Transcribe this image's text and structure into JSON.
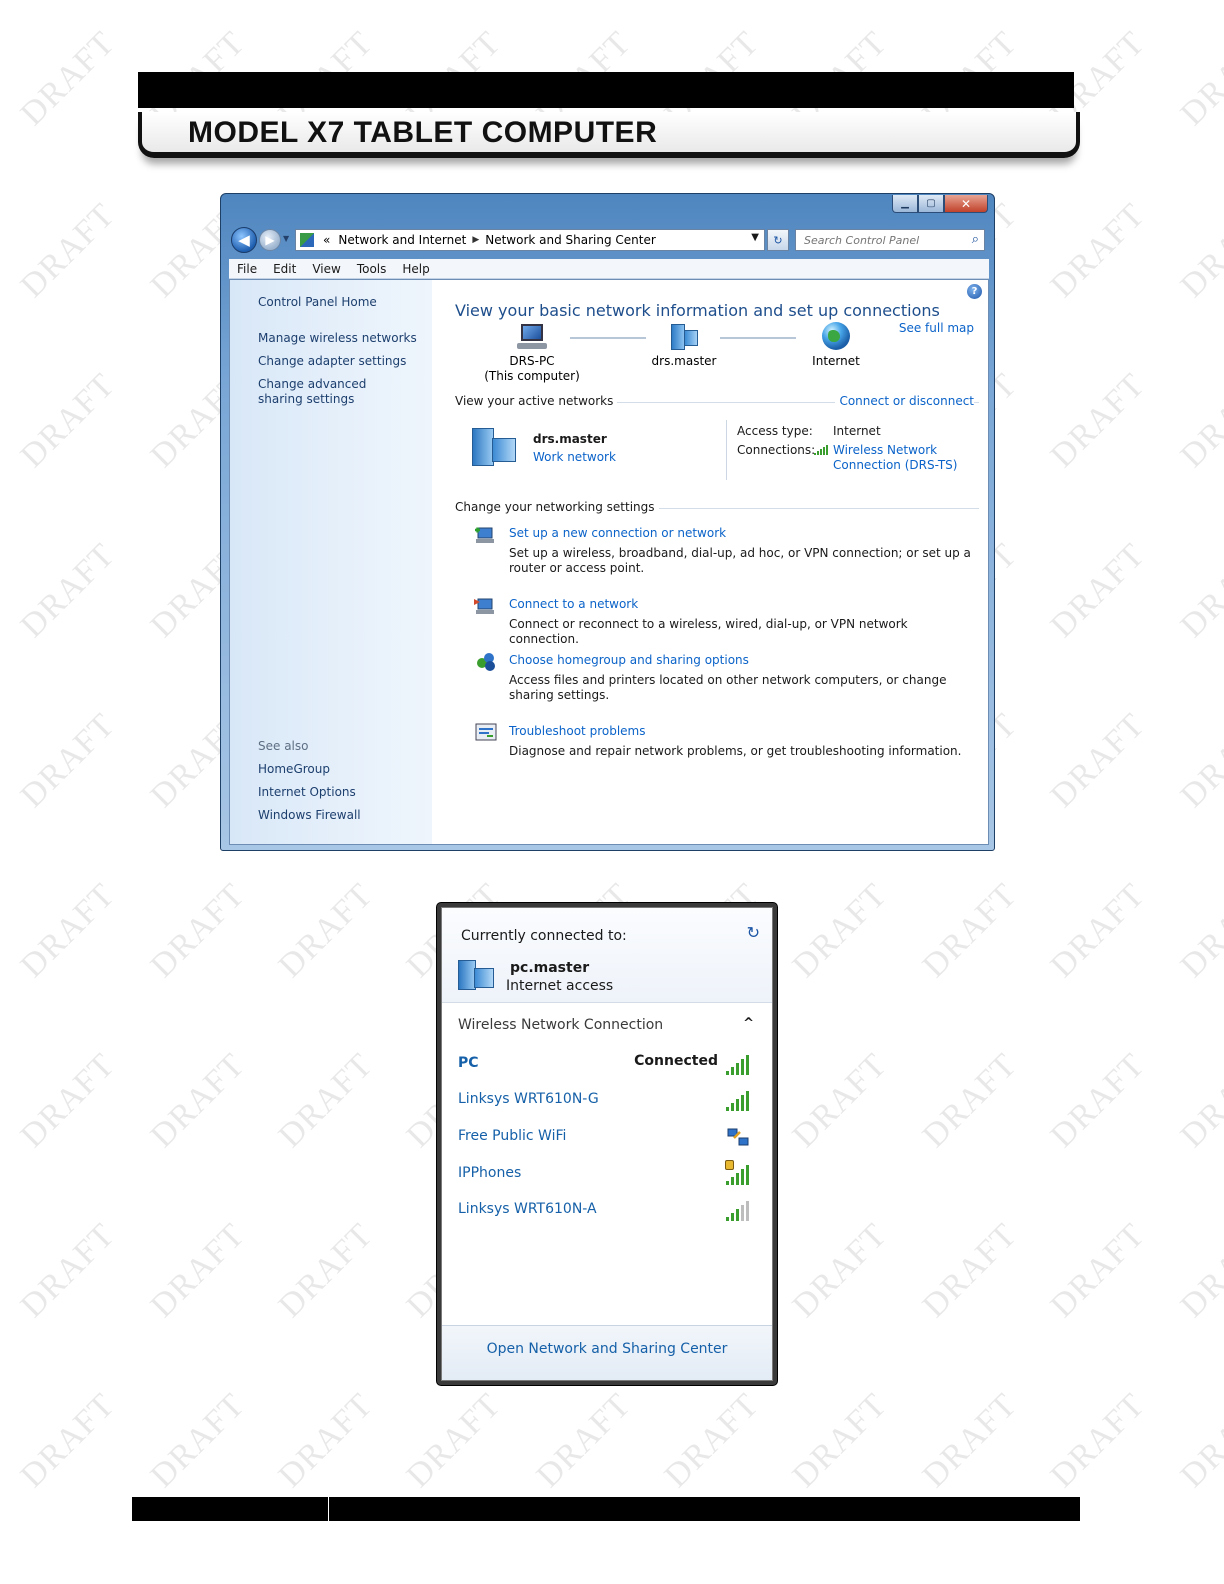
{
  "document": {
    "header_title": "MODEL X7 TABLET COMPUTER",
    "watermark": "DRAFT"
  },
  "window": {
    "address": {
      "overflow": "«",
      "crumbs": [
        "Network and Internet",
        "Network and Sharing Center"
      ]
    },
    "search_placeholder": "Search Control Panel",
    "menu": [
      "File",
      "Edit",
      "View",
      "Tools",
      "Help"
    ],
    "sidebar": {
      "home": "Control Panel Home",
      "links": [
        "Manage wireless networks",
        "Change adapter settings",
        "Change advanced sharing settings"
      ],
      "see_also_label": "See also",
      "see_also": [
        "HomeGroup",
        "Internet Options",
        "Windows Firewall"
      ]
    },
    "main": {
      "heading": "View your basic network information and set up connections",
      "see_full_map": "See full map",
      "map": {
        "computer_name": "DRS-PC",
        "computer_note": "(This computer)",
        "network_name": "drs.master",
        "internet_label": "Internet"
      },
      "active": {
        "section_label": "View your active networks",
        "connect_link": "Connect or disconnect",
        "network_name": "drs.master",
        "network_type": "Work network",
        "access_type_label": "Access type:",
        "access_type_value": "Internet",
        "connections_label": "Connections:",
        "connection_line1": "Wireless Network",
        "connection_line2": "Connection (DRS-TS)"
      },
      "settings": {
        "section_label": "Change your networking settings",
        "tasks": [
          {
            "title": "Set up a new connection or network",
            "desc": "Set up a wireless, broadband, dial-up, ad hoc, or VPN connection; or set up a router or access point."
          },
          {
            "title": "Connect to a network",
            "desc": "Connect or reconnect to a wireless, wired, dial-up, or VPN network connection."
          },
          {
            "title": "Choose homegroup and sharing options",
            "desc": "Access files and printers located on other network computers, or change sharing settings."
          },
          {
            "title": "Troubleshoot problems",
            "desc": "Diagnose and repair network problems, or get troubleshooting information."
          }
        ]
      }
    }
  },
  "flyout": {
    "currently_connected_label": "Currently connected to:",
    "current_network": "pc.master",
    "current_access": "Internet access",
    "section_label": "Wireless Network Connection",
    "networks": [
      {
        "name": "PC",
        "status": "Connected",
        "signal_bars": 5,
        "secured": false
      },
      {
        "name": "Linksys WRT610N-G",
        "status": "",
        "signal_bars": 5,
        "secured": false
      },
      {
        "name": "Free Public WiFi",
        "status": "",
        "signal_bars": 0,
        "secured": false,
        "adhoc": true
      },
      {
        "name": "IPPhones",
        "status": "",
        "signal_bars": 5,
        "secured": true
      },
      {
        "name": "Linksys WRT610N-A",
        "status": "",
        "signal_bars": 3,
        "secured": false
      }
    ],
    "open_center_link": "Open Network and Sharing Center"
  },
  "colors": {
    "link": "#0b63c9",
    "heading": "#1e4e8c",
    "signal_green": "#3a9e2f"
  }
}
